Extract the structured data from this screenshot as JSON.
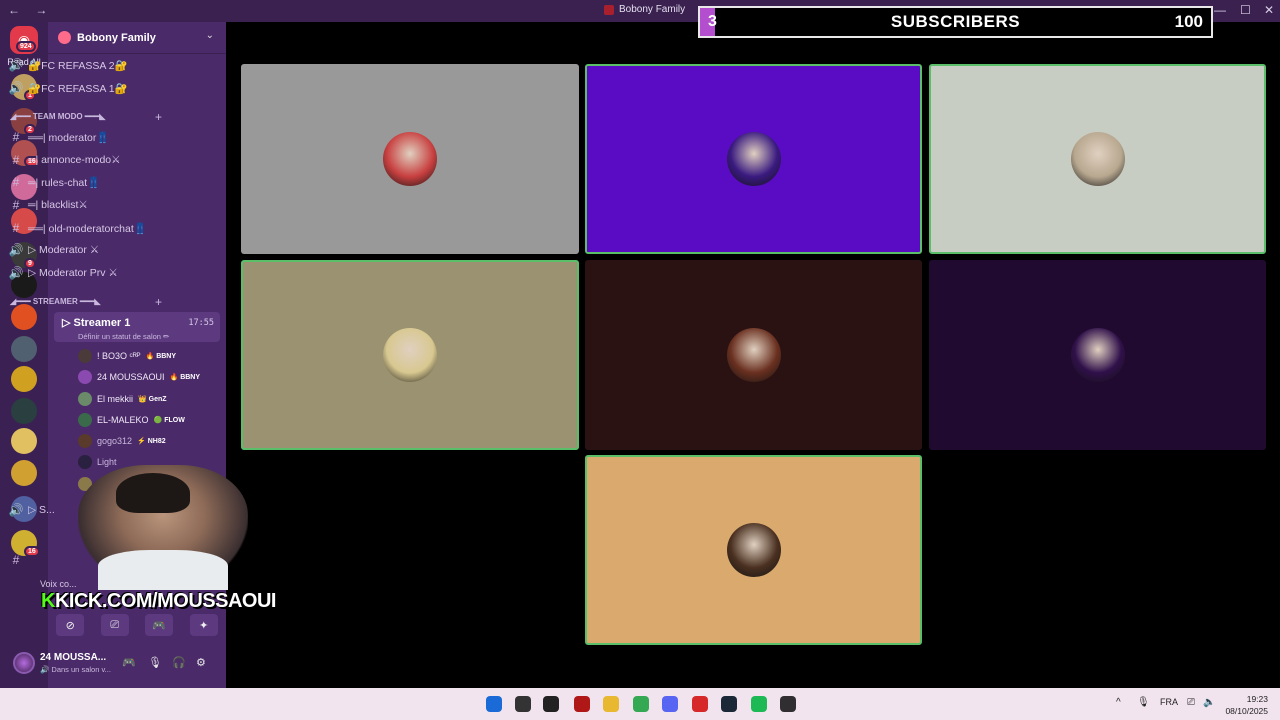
{
  "window": {
    "title": "Bobony Family",
    "nav_label": "← →",
    "minimize": "—",
    "maximize": "☐",
    "close": "✕"
  },
  "subscriber_bar": {
    "current": "3",
    "label": "SUBSCRIBERS",
    "goal": "100",
    "progress_fraction": 0.03,
    "fill_color": "#b34fcf"
  },
  "rail": {
    "home_badge": "924",
    "read_all": "Read All",
    "servers": [
      {
        "color": "#c0a060",
        "badge": "1"
      },
      {
        "color": "#8a4040",
        "badge": "2"
      },
      {
        "color": "#b05050",
        "badge": "16"
      },
      {
        "color": "#d06a9a",
        "badge": ""
      },
      {
        "color": "#d64a4a",
        "badge": ""
      },
      {
        "color": "#3a3a3a",
        "badge": "9"
      },
      {
        "color": "#1a1a1a",
        "badge": ""
      },
      {
        "color": "#e05020",
        "badge": ""
      },
      {
        "color": "#506070",
        "badge": ""
      },
      {
        "color": "#d0a020",
        "badge": ""
      },
      {
        "color": "#2a4040",
        "badge": ""
      },
      {
        "color": "#e0c060",
        "badge": ""
      },
      {
        "color": "#d0a030",
        "badge": ""
      },
      {
        "color": "#5060a0",
        "badge": ""
      },
      {
        "color": "#d0b030",
        "badge": "16"
      }
    ]
  },
  "sidebar": {
    "server_name": "Bobony Family",
    "channels_top": [
      {
        "icon": "voice",
        "label": "🔐FC REFASSA 2🔐"
      },
      {
        "icon": "voice",
        "label": "🔐FC REFASSA 1🔐"
      }
    ],
    "category_modo": "◢━━━ TEAM MODO ━━━◣",
    "modo_channels": [
      {
        "icon": "#",
        "label": "══| moderator👖"
      },
      {
        "icon": "#",
        "label": "═| annonce-modo⚔"
      },
      {
        "icon": "#",
        "label": "═| rules-chat👖"
      },
      {
        "icon": "#",
        "label": "═| blacklist⚔"
      },
      {
        "icon": "#",
        "label": "══| old-moderatorchat👖"
      },
      {
        "icon": "voice",
        "label": "▷ Moderator ⚔"
      },
      {
        "icon": "voice",
        "label": "▷ Moderator Prv ⚔"
      }
    ],
    "category_streamer": "◢━━━ STREAMER ━━━◣",
    "active_channel": {
      "label": "▷ Streamer 1",
      "time": "17:55",
      "status": "Définir un statut de salon ✏"
    },
    "members": [
      {
        "name": "! BO3O ᶜᴿᴾ",
        "tag": "🔥 BBNY",
        "color": "#4a3a3a"
      },
      {
        "name": "24 MOUSSAOUI",
        "tag": "🔥 BBNY",
        "color": "#8a4ab0"
      },
      {
        "name": "El mekkii",
        "tag": "👑 GenZ",
        "color": "#6a8a6a"
      },
      {
        "name": "EL-MALEKO",
        "tag": "🟢 FLOW",
        "color": "#3a6a4a"
      },
      {
        "name": "gogo312",
        "tag": "⚡ NH82",
        "color": "#5a3a2a"
      },
      {
        "name": "Light",
        "tag": "",
        "color": "#2a2040"
      },
      {
        "name": "Sa...",
        "tag": "NH82",
        "color": "#8a7a4a"
      }
    ],
    "partial_row": "▷ S...",
    "partial_row2": "#"
  },
  "user_panel": {
    "voice_status": "Voix co...",
    "name": "24 MOUSSA...",
    "status": "🔊 Dans un salon v...",
    "controls": [
      "⊘",
      "⎚",
      "🎮",
      "✦"
    ],
    "icons": [
      "🎮",
      "🎙",
      "🎧",
      "⚙"
    ]
  },
  "overlay": {
    "kick_k": "K",
    "kick_text": "KICK.COM/MOUSSAOUI"
  },
  "video_tiles": [
    {
      "bg": "#999999",
      "speaking": false,
      "avatar": "#c84040"
    },
    {
      "bg": "#5a0bc4",
      "speaking": true,
      "avatar": "#3a1a80"
    },
    {
      "bg": "#c8cdc4",
      "speaking": true,
      "avatar": "#b8a890"
    },
    {
      "bg": "#9a9270",
      "speaking": true,
      "avatar": "#d8c890"
    },
    {
      "bg": "#2b1212",
      "speaking": false,
      "avatar": "#6a3020"
    },
    {
      "bg": "#200a30",
      "speaking": false,
      "avatar": "#30104a"
    },
    {
      "bg": "#d9a96e",
      "speaking": true,
      "avatar": "#4a3020"
    }
  ],
  "taskbar": {
    "icons": [
      {
        "name": "windows-start-icon",
        "color": "#1a6ad8"
      },
      {
        "name": "search-icon",
        "color": "#333333"
      },
      {
        "name": "task-view-icon",
        "color": "#222222"
      },
      {
        "name": "app-red-icon",
        "color": "#b01818"
      },
      {
        "name": "file-explorer-icon",
        "color": "#e8b830"
      },
      {
        "name": "chrome-icon",
        "color": "#34a853"
      },
      {
        "name": "discord-icon",
        "color": "#5865f2"
      },
      {
        "name": "app-b-icon",
        "color": "#d62828"
      },
      {
        "name": "steam-icon",
        "color": "#1b2838"
      },
      {
        "name": "spotify-icon",
        "color": "#1db954"
      },
      {
        "name": "obs-icon",
        "color": "#302e31"
      }
    ],
    "tray_lang": "FRA",
    "tray_arrow": "^",
    "tray_mic": "🎙",
    "tray_net": "⎚",
    "tray_vol": "🔈",
    "time": "19:23",
    "date": "08/10/2025"
  }
}
